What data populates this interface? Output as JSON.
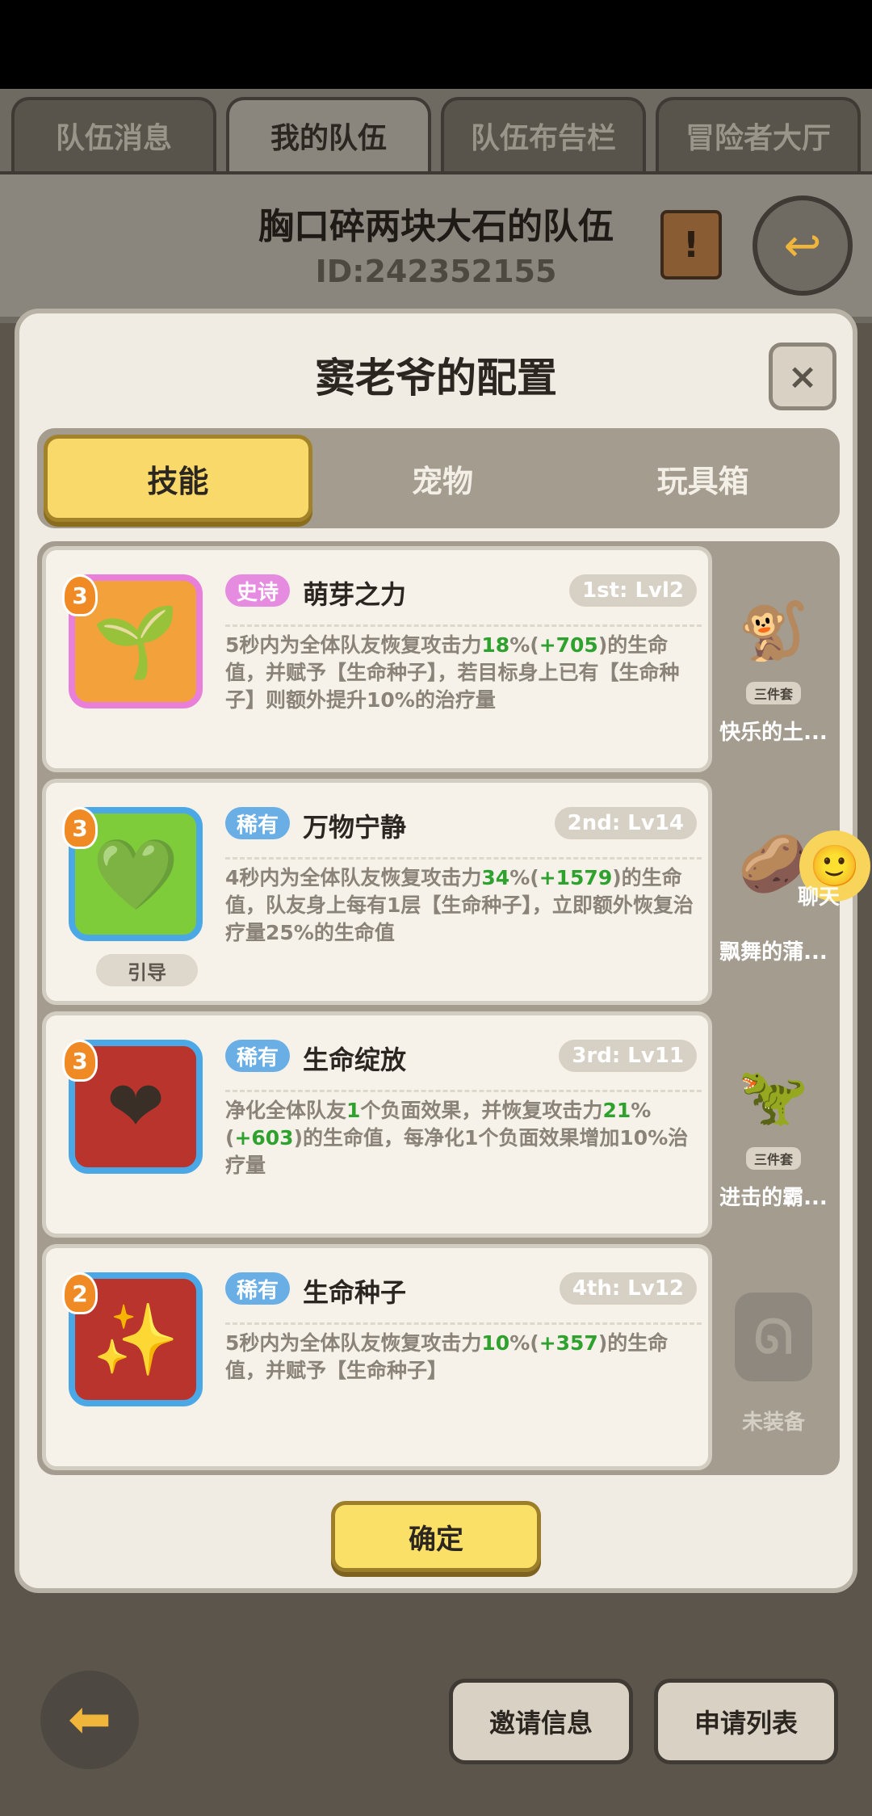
{
  "tabs": [
    "队伍消息",
    "我的队伍",
    "队伍布告栏",
    "冒险者大厅"
  ],
  "team": {
    "name": "胸口碎两块大石的队伍",
    "id": "ID:242352155"
  },
  "modal": {
    "title": "窦老爷的配置",
    "close": "×",
    "segments": [
      "技能",
      "宠物",
      "玩具箱"
    ],
    "confirm": "确定"
  },
  "skills": [
    {
      "level": "3",
      "rarity": "史诗",
      "name": "萌芽之力",
      "slot": "1st: Lvl2",
      "desc": [
        {
          "t": "5秒内为全体队友恢复攻击力"
        },
        {
          "t": "18",
          "g": true
        },
        {
          "t": "%("
        },
        {
          "t": "+705",
          "g": true
        },
        {
          "t": ")的生命值，并赋予【生命种子】，若目标身上已有【生命种子】则额外提升10%的治疗量"
        }
      ],
      "icon": "sprout-burst-icon",
      "icon_glyph": "🌱"
    },
    {
      "level": "3",
      "rarity": "稀有",
      "name": "万物宁静",
      "slot": "2nd: Lv14",
      "tag": "引导",
      "desc": [
        {
          "t": "4秒内为全体队友恢复攻击力"
        },
        {
          "t": "34",
          "g": true
        },
        {
          "t": "%("
        },
        {
          "t": "+1579",
          "g": true
        },
        {
          "t": ")的生命值，队友身上每有1层【生命种子】，立即额外恢复治疗量25%的生命值"
        }
      ],
      "icon": "heart-leaf-icon",
      "icon_glyph": "💚"
    },
    {
      "level": "3",
      "rarity": "稀有",
      "name": "生命绽放",
      "slot": "3rd: Lv11",
      "desc": [
        {
          "t": "净化全体队友"
        },
        {
          "t": "1",
          "g": true
        },
        {
          "t": "个负面效果，并恢复攻击力"
        },
        {
          "t": "21",
          "g": true
        },
        {
          "t": "%("
        },
        {
          "t": "+603",
          "g": true
        },
        {
          "t": ")的生命值，每净化1个负面效果增加10%治疗量"
        }
      ],
      "icon": "heart-flower-icon",
      "icon_glyph": "❤"
    },
    {
      "level": "2",
      "rarity": "稀有",
      "name": "生命种子",
      "slot": "4th: Lv12",
      "desc": [
        {
          "t": "5秒内为全体队友恢复攻击力"
        },
        {
          "t": "10",
          "g": true
        },
        {
          "t": "%("
        },
        {
          "t": "+357",
          "g": true
        },
        {
          "t": ")的生命值，并赋予【生命种子】"
        }
      ],
      "icon": "seed-swirl-icon",
      "icon_glyph": "✨"
    }
  ],
  "pets": [
    {
      "name": "快乐的土...",
      "tag": "三件套",
      "glyph": "🐒"
    },
    {
      "name": "飘舞的蒲...",
      "tag": "",
      "glyph": "🥔"
    },
    {
      "name": "进击的霸...",
      "tag": "三件套",
      "glyph": "🦖"
    },
    {
      "name": "未装备",
      "empty": true
    }
  ],
  "chat": {
    "label": "聊天"
  },
  "bottom": {
    "invite": "邀请信息",
    "apply": "申请列表"
  }
}
